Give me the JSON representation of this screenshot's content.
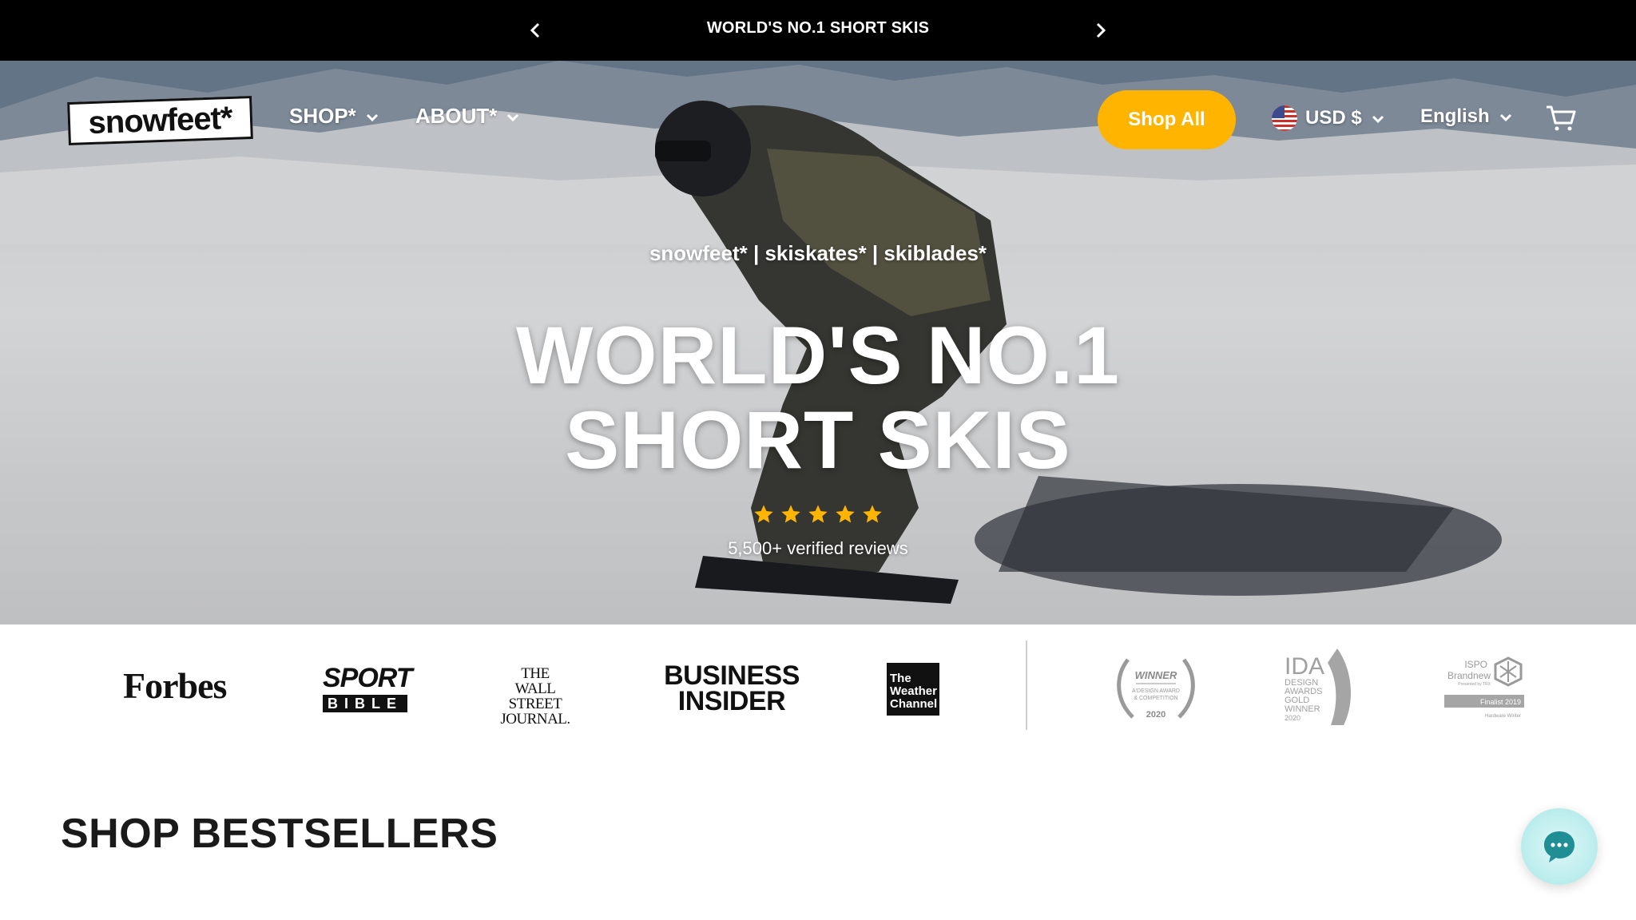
{
  "announcement": {
    "text": "WORLD'S NO.1 SHORT SKIS"
  },
  "header": {
    "logo_text": "snowfeet*",
    "nav": [
      {
        "label": "SHOP*"
      },
      {
        "label": "ABOUT*"
      }
    ],
    "shop_all_label": "Shop All",
    "currency_label": "USD $",
    "language_label": "English",
    "accent_color": "#ffb400"
  },
  "hero": {
    "subtitle": "snowfeet* | skiskates* | skiblades*",
    "title_line1": "WORLD'S NO.1",
    "title_line2": "SHORT SKIS",
    "rating_stars": 5,
    "reviews_text": "5,500+ verified reviews"
  },
  "press": {
    "forbes": "Forbes",
    "sport_bible_top": "SPORT",
    "sport_bible_bottom": "BIBLE",
    "wsj_line1": "THE",
    "wsj_line2": "WALL STREET",
    "wsj_line3": "JOURNAL.",
    "bi_line1": "BUSINESS",
    "bi_line2": "INSIDER",
    "weather_line1": "The",
    "weather_line2": "Weather",
    "weather_line3": "Channel",
    "award1_line1": "WINNER",
    "award1_line2": "A'DESIGN AWARD",
    "award1_line3": "& COMPETITION",
    "award1_year": "2020",
    "award2_logo": "IDA",
    "award2_line1": "DESIGN",
    "award2_line2": "AWARDS",
    "award2_line3": "GOLD",
    "award2_line4": "WINNER",
    "award2_year": "2020",
    "award3_line1": "ISPO",
    "award3_line2": "Brandnew",
    "award3_line3": "Presented by TRX",
    "award3_line4": "Finalist 2019",
    "award3_line5": "Hardware Winter"
  },
  "bestsellers": {
    "title": "SHOP BESTSELLERS"
  }
}
